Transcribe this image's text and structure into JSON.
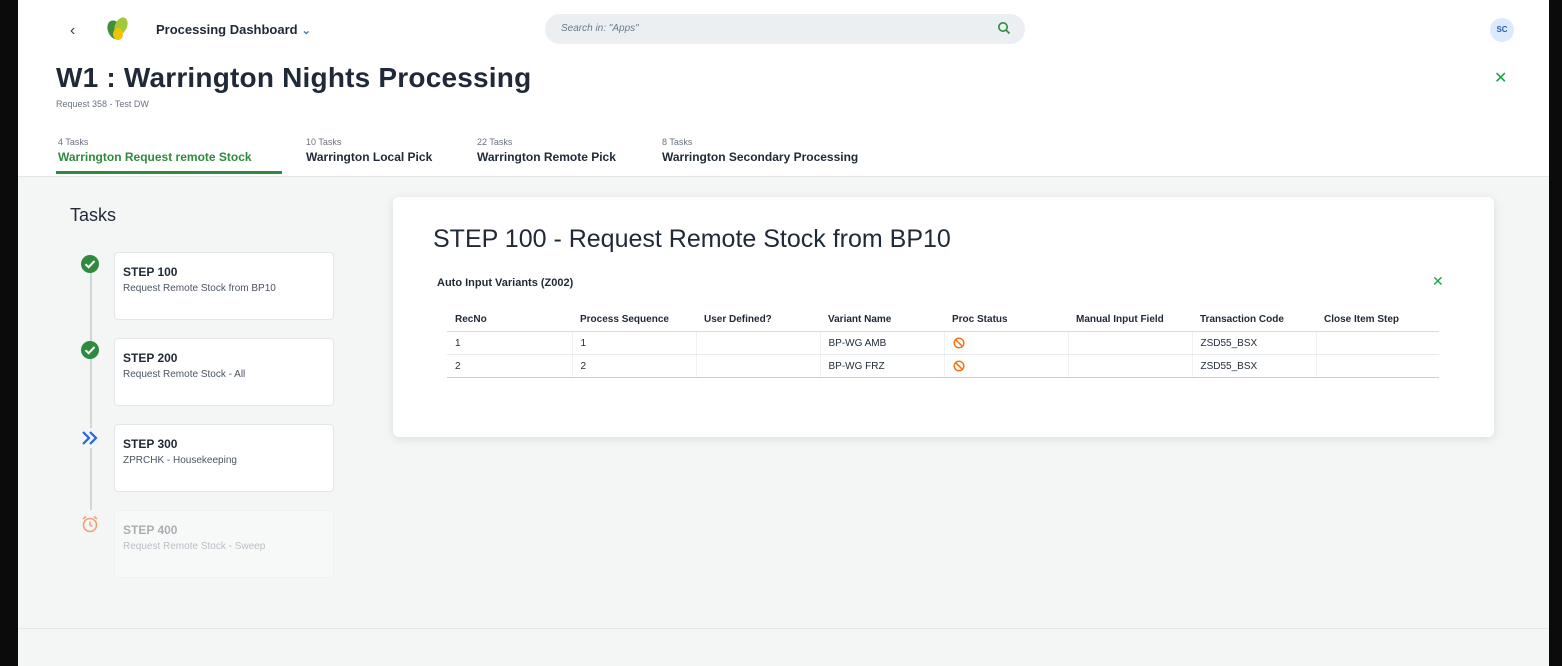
{
  "shell": {
    "app_title": "Processing Dashboard",
    "search_placeholder": "Search in: \"Apps\"",
    "avatar_initials": "SC"
  },
  "header": {
    "title": "W1 : Warrington Nights Processing",
    "subtitle": "Request 358 - Test DW"
  },
  "tabs": [
    {
      "count": "4 Tasks",
      "label": "Warrington Request remote Stock",
      "active": true
    },
    {
      "count": "10 Tasks",
      "label": "Warrington Local Pick"
    },
    {
      "count": "22 Tasks",
      "label": "Warrington Remote Pick"
    },
    {
      "count": "8 Tasks",
      "label": "Warrington Secondary Processing"
    }
  ],
  "tasks_panel": {
    "title": "Tasks",
    "steps": [
      {
        "title": "STEP 100",
        "desc": "Request Remote Stock from BP10",
        "status": "complete",
        "icon": "check-circle-icon"
      },
      {
        "title": "STEP 200",
        "desc": "Request Remote Stock - All",
        "status": "complete",
        "icon": "check-circle-icon"
      },
      {
        "title": "STEP 300",
        "desc": "ZPRCHK - Housekeeping",
        "status": "in-progress",
        "icon": "double-chevron-right-icon"
      },
      {
        "title": "STEP 400",
        "desc": "Request Remote Stock - Sweep",
        "status": "pending",
        "icon": "alarm-clock-icon"
      }
    ]
  },
  "detail": {
    "title": "STEP 100 - Request Remote Stock from BP10",
    "section_title": "Auto Input Variants (Z002)",
    "columns": [
      "RecNo",
      "Process Sequence",
      "User Defined?",
      "Variant Name",
      "Proc Status",
      "Manual Input Field",
      "Transaction Code",
      "Close Item Step"
    ],
    "rows": [
      {
        "recno": "1",
        "process_sequence": "1",
        "user_defined": "",
        "variant_name": "BP-WG AMB",
        "proc_status": "not-allowed-icon",
        "manual_input": "",
        "transaction_code": "ZSD55_BSX",
        "close_item_step": ""
      },
      {
        "recno": "2",
        "process_sequence": "2",
        "user_defined": "",
        "variant_name": "BP-WG FRZ",
        "proc_status": "not-allowed-icon",
        "manual_input": "",
        "transaction_code": "ZSD55_BSX",
        "close_item_step": ""
      }
    ]
  },
  "colors": {
    "accent_green": "#2e8b3e",
    "in_progress_blue": "#2563eb",
    "warning_orange": "#f97316",
    "pending_orange": "#f59e73"
  }
}
